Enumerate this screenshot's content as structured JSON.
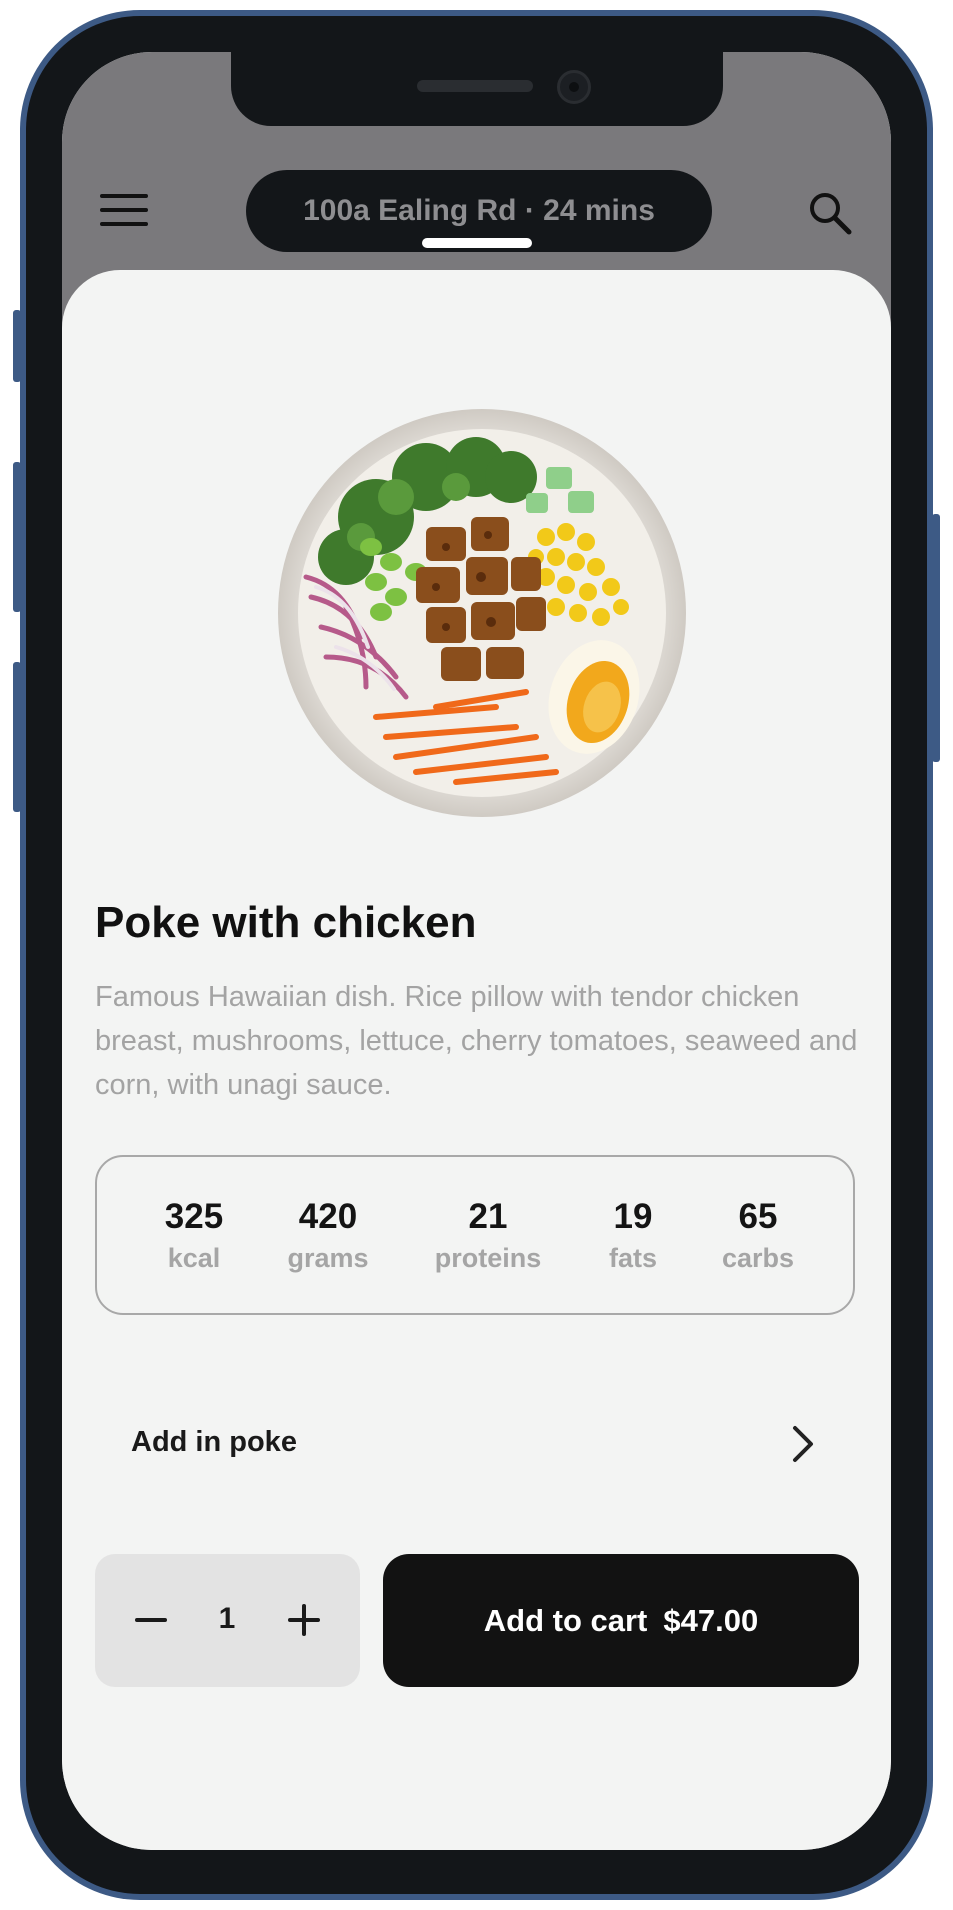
{
  "header": {
    "location": "100a Ealing Rd · 24 mins",
    "menu_icon": "hamburger-menu-icon",
    "search_icon": "search-icon"
  },
  "product": {
    "title": "Poke with chicken",
    "description": "Famous Hawaiian dish. Rice pillow with tendor chicken breast, mushrooms, lettuce, cherry tomatoes, seaweed and corn, with unagi sauce."
  },
  "nutrition": [
    {
      "value": "325",
      "label": "kcal"
    },
    {
      "value": "420",
      "label": "grams"
    },
    {
      "value": "21",
      "label": "proteins"
    },
    {
      "value": "19",
      "label": "fats"
    },
    {
      "value": "65",
      "label": "carbs"
    }
  ],
  "addons": {
    "label": "Add in poke",
    "icon": "chevron-right-icon"
  },
  "quantity": {
    "value": "1",
    "minus_icon": "minus-icon",
    "plus_icon": "plus-icon"
  },
  "cart": {
    "label": "Add to cart",
    "price": "$47.00"
  },
  "colors": {
    "primary_button": "#121212",
    "background": "#f3f4f3",
    "muted_text": "#a3a3a3",
    "phone_frame": "#3d5a85"
  }
}
